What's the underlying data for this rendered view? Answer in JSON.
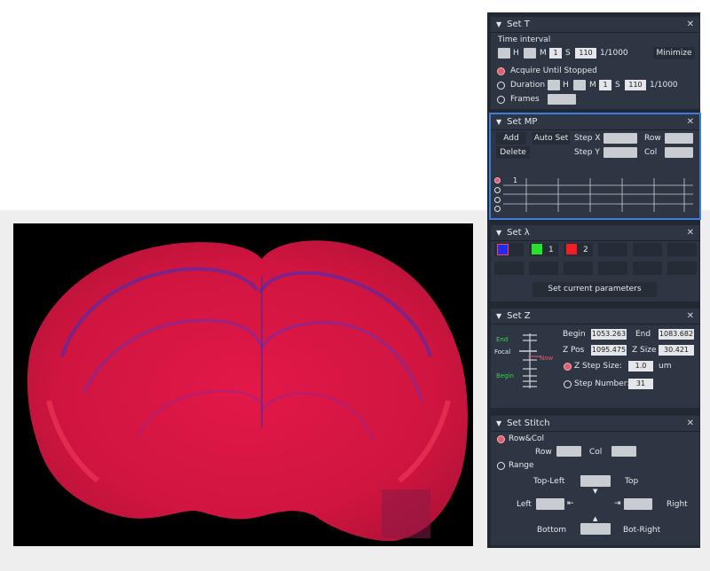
{
  "set_t": {
    "title": "Set T",
    "time_interval_label": "Time interval",
    "h": "H",
    "m": "M",
    "s": "S",
    "interval_m": "1",
    "interval_s": "110",
    "unit": "1/1000",
    "minimize": "Minimize",
    "acquire_until_stopped": "Acquire Until Stopped",
    "duration": "Duration",
    "duration_m": "1",
    "duration_s": "110",
    "frames": "Frames"
  },
  "set_mp": {
    "title": "Set MP",
    "add": "Add",
    "auto_set": "Auto Set",
    "delete": "Delete",
    "step_x": "Step X",
    "step_y": "Step Y",
    "row": "Row",
    "col": "Col",
    "list_first": "1"
  },
  "set_lambda": {
    "title": "Set λ",
    "ch1": "1",
    "ch2": "2",
    "set_current": "Set current parameters",
    "colors": {
      "ch0": "#1f2cf0",
      "ch1": "#22e52a",
      "ch2": "#f01e24"
    }
  },
  "set_z": {
    "title": "Set Z",
    "end_marker": "End",
    "focal": "Focal",
    "now": "Now",
    "begin_marker": "Begin",
    "begin": "Begin",
    "begin_value": "1053.263",
    "end": "End",
    "end_value": "1083.682",
    "zpos": "Z Pos",
    "zpos_value": "1095.475",
    "zsize": "Z Size",
    "zsize_value": "30.421",
    "step_size": "Z Step Size:",
    "step_size_value": "1.0",
    "um": "um",
    "step_number": "Step Number:",
    "step_number_value": "31"
  },
  "set_stitch": {
    "title": "Set Stitch",
    "rowcol": "Row&Col",
    "row": "Row",
    "col": "Col",
    "range": "Range",
    "top_left": "Top-Left",
    "top": "Top",
    "left": "Left",
    "right": "Right",
    "bottom": "Bottom",
    "bot_right": "Bot-Right"
  }
}
